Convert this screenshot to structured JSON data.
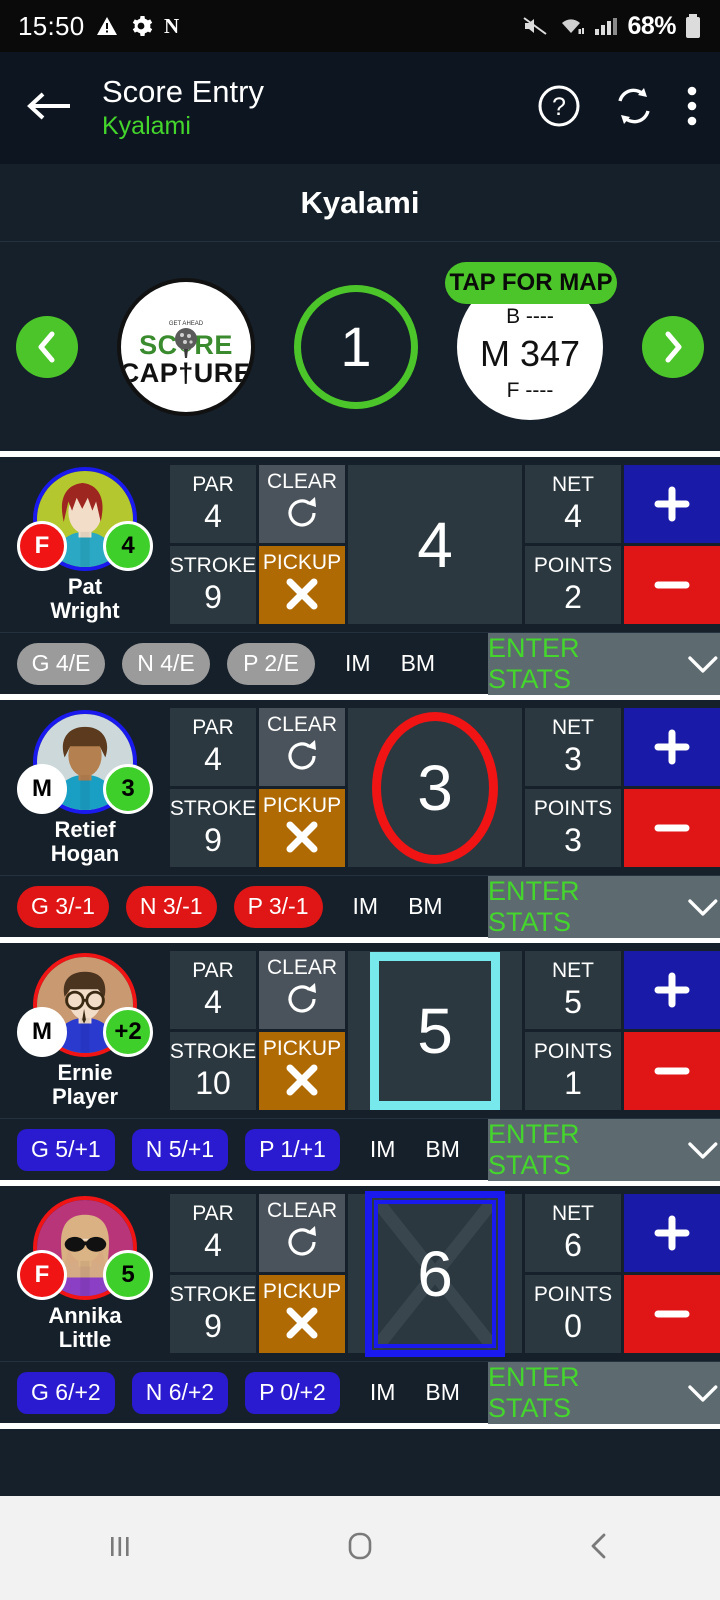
{
  "status_bar": {
    "time": "15:50",
    "battery_text": "68%",
    "icons": [
      "warning-triangle-icon",
      "gear-icon",
      "letter-n-icon",
      "mute-icon",
      "wifi-icon",
      "cellular-signal-icon",
      "battery-icon"
    ]
  },
  "app_bar": {
    "back_label": "back-arrow",
    "title": "Score Entry",
    "subtitle": "Kyalami",
    "actions": [
      "help-icon",
      "sync-icon",
      "overflow-menu-icon"
    ]
  },
  "course_banner": {
    "name": "Kyalami"
  },
  "hole_nav": {
    "prev_label": "‹",
    "next_label": "›",
    "logo": {
      "line1": "SC○RE",
      "line2": "CAP†URE",
      "alt": "Score Capture logo"
    },
    "hole_number": "1",
    "distance": {
      "back": "B ----",
      "middle": "M 347",
      "front": "F ----"
    },
    "map_button": "TAP FOR MAP"
  },
  "labels": {
    "par": "PAR",
    "clear": "CLEAR",
    "stroke": "STROKE",
    "pickup": "PICKUP",
    "net": "NET",
    "points": "POINTS",
    "plus": "+",
    "minus": "−",
    "im": "IM",
    "bm": "BM",
    "enter_stats": "ENTER STATS"
  },
  "colors": {
    "accent_green": "#44d62c",
    "arrow_green": "#4cc52a",
    "pickup_orange": "#b06a04",
    "clear_grey": "#4a535b",
    "cell_grey": "#2b3840",
    "plus_blue": "#1a1aa8",
    "minus_red": "#e01515",
    "panel_dark": "#16202a",
    "score_red": "#f01414",
    "score_cyan": "#77e8ec",
    "score_blue": "#1a1aef",
    "badge_green": "#3fcf2a",
    "badge_red": "#f01414",
    "badge_white": "#ffffff"
  },
  "players": [
    {
      "name_line1": "Pat",
      "name_line2": "Wright",
      "avatar": {
        "ring_color": "#1a1aef",
        "bg_color": "#b5c72e",
        "hair_color": "#9e2620",
        "skin_color": "#f2ddc8",
        "shirt_color": "#2aa8c4",
        "accessory": "none"
      },
      "badge_left": {
        "text": "F",
        "bg": "#f01414",
        "fg": "#ffffff"
      },
      "badge_right": {
        "text": "4",
        "bg": "#3fcf2a",
        "fg": "#000000"
      },
      "par": "4",
      "stroke": "9",
      "score": "4",
      "score_marker": "none",
      "net": "4",
      "points": "2",
      "chips": [
        {
          "text": "G 4/E",
          "bg": "#9b9b9b",
          "fg": "#ffffff",
          "shape": "pill"
        },
        {
          "text": "N 4/E",
          "bg": "#9b9b9b",
          "fg": "#ffffff",
          "shape": "pill"
        },
        {
          "text": "P 2/E",
          "bg": "#9b9b9b",
          "fg": "#ffffff",
          "shape": "pill"
        }
      ]
    },
    {
      "name_line1": "Retief",
      "name_line2": "Hogan",
      "avatar": {
        "ring_color": "#1a1aef",
        "bg_color": "#ccd8da",
        "hair_color": "#5b3a1e",
        "skin_color": "#b5804f",
        "shirt_color": "#1a9fc4",
        "accessory": "none"
      },
      "badge_left": {
        "text": "M",
        "bg": "#ffffff",
        "fg": "#000000"
      },
      "badge_right": {
        "text": "3",
        "bg": "#3fcf2a",
        "fg": "#000000"
      },
      "par": "4",
      "stroke": "9",
      "score": "3",
      "score_marker": "circle-red",
      "net": "3",
      "points": "3",
      "chips": [
        {
          "text": "G 3/-1",
          "bg": "#e01515",
          "fg": "#ffffff",
          "shape": "pill"
        },
        {
          "text": "N 3/-1",
          "bg": "#e01515",
          "fg": "#ffffff",
          "shape": "pill"
        },
        {
          "text": "P 3/-1",
          "bg": "#e01515",
          "fg": "#ffffff",
          "shape": "pill"
        }
      ]
    },
    {
      "name_line1": "Ernie",
      "name_line2": "Player",
      "avatar": {
        "ring_color": "#f01414",
        "bg_color": "#c99a72",
        "hair_color": "#4a3420",
        "skin_color": "#f2ddc8",
        "shirt_color": "#2a3acf",
        "accessory": "glasses"
      },
      "badge_left": {
        "text": "M",
        "bg": "#ffffff",
        "fg": "#000000"
      },
      "badge_right": {
        "text": "+2",
        "bg": "#3fcf2a",
        "fg": "#000000"
      },
      "par": "4",
      "stroke": "10",
      "score": "5",
      "score_marker": "square-cyan",
      "net": "5",
      "points": "1",
      "chips": [
        {
          "text": "G 5/+1",
          "bg": "#2a1ad0",
          "fg": "#ffffff",
          "shape": "rounded"
        },
        {
          "text": "N 5/+1",
          "bg": "#2a1ad0",
          "fg": "#ffffff",
          "shape": "rounded"
        },
        {
          "text": "P 1/+1",
          "bg": "#2a1ad0",
          "fg": "#ffffff",
          "shape": "rounded"
        }
      ]
    },
    {
      "name_line1": "Annika",
      "name_line2": "Little",
      "avatar": {
        "ring_color": "#f01414",
        "bg_color": "#b8357a",
        "hair_color": "#d9b182",
        "skin_color": "#f2ddc8",
        "shirt_color": "#8a3fc4",
        "accessory": "sunglasses"
      },
      "badge_left": {
        "text": "F",
        "bg": "#f01414",
        "fg": "#ffffff"
      },
      "badge_right": {
        "text": "5",
        "bg": "#3fcf2a",
        "fg": "#000000"
      },
      "par": "4",
      "stroke": "9",
      "score": "6",
      "score_marker": "double-square-blue-x",
      "net": "6",
      "points": "0",
      "chips": [
        {
          "text": "G 6/+2",
          "bg": "#2a1ad0",
          "fg": "#ffffff",
          "shape": "rounded"
        },
        {
          "text": "N 6/+2",
          "bg": "#2a1ad0",
          "fg": "#ffffff",
          "shape": "rounded"
        },
        {
          "text": "P 0/+2",
          "bg": "#2a1ad0",
          "fg": "#ffffff",
          "shape": "rounded"
        }
      ]
    }
  ],
  "system_nav": {
    "recents": "recents-icon",
    "home": "home-icon",
    "back": "back-icon"
  }
}
